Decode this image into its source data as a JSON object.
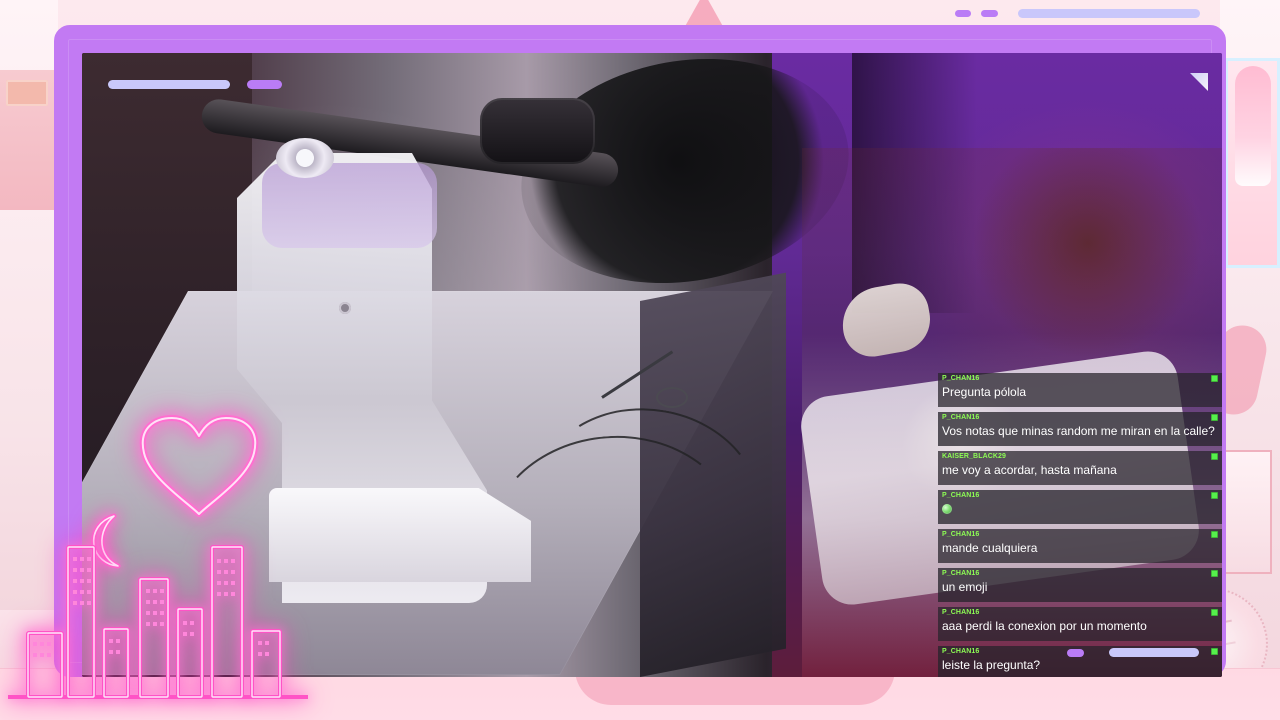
{
  "overlay": {
    "accent_color": "#c27af3",
    "chat_username_color": "#8dfd54",
    "chat_badge_color": "#56f04c"
  },
  "icons": {
    "heart": "heart-icon",
    "moon": "moon-icon",
    "city": "city-skyline-icon",
    "chat_badge": "chat-badge-icon",
    "emoji": "emoji-icon"
  },
  "chat": {
    "messages": [
      {
        "username": "P_CHAN16",
        "text": "Pregunta pólola"
      },
      {
        "username": "P_CHAN16",
        "text": "Vos notas que minas random me miran en la calle?"
      },
      {
        "username": "KAISER_BLACK29",
        "text": "me voy a acordar, hasta mañana"
      },
      {
        "username": "P_CHAN16",
        "text": ""
      },
      {
        "username": "P_CHAN16",
        "text": "mande cualquiera"
      },
      {
        "username": "P_CHAN16",
        "text": "un emoji"
      },
      {
        "username": "P_CHAN16",
        "text": "aaa perdi la conexion por un momento"
      },
      {
        "username": "P_CHAN16",
        "text": "leiste la pregunta?"
      }
    ]
  }
}
